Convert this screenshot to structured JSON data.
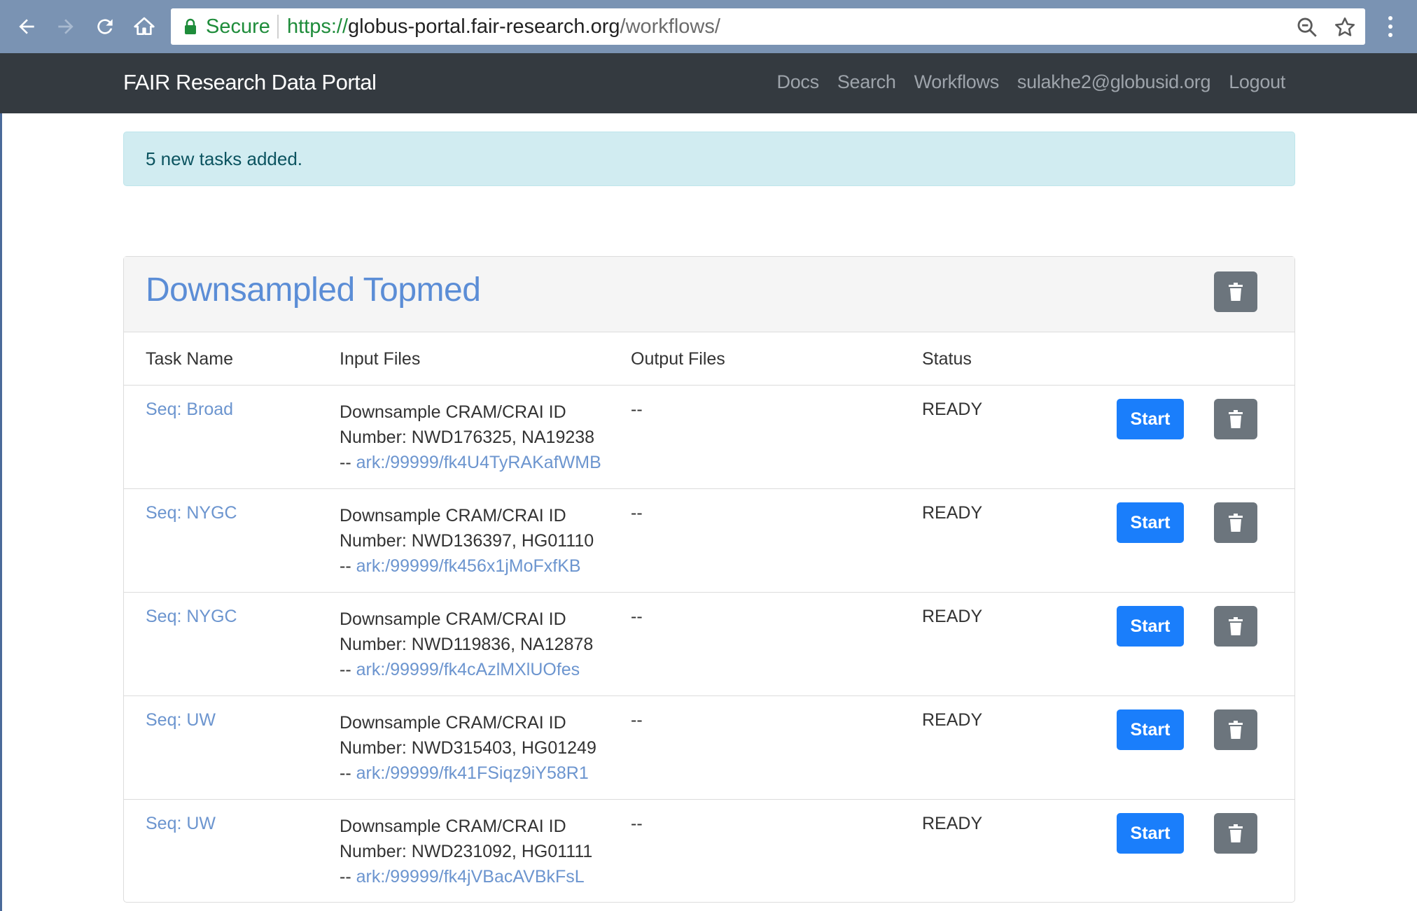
{
  "browser": {
    "secure_label": "Secure",
    "url_scheme": "https://",
    "url_host": "globus-portal.fair-research.org",
    "url_path": "/workflows/"
  },
  "navbar": {
    "brand": "FAIR Research Data Portal",
    "links": [
      "Docs",
      "Search",
      "Workflows",
      "sulakhe2@globusid.org",
      "Logout"
    ]
  },
  "alert": {
    "message": "5 new tasks added."
  },
  "workflow": {
    "title": "Downsampled Topmed",
    "columns": [
      "Task Name",
      "Input Files",
      "Output Files",
      "Status"
    ],
    "start_label": "Start",
    "tasks": [
      {
        "name": "Seq: Broad",
        "input_line1": "Downsample CRAM/CRAI ID",
        "input_line2": "Number: NWD176325, NA19238",
        "ark_prefix": "-- ",
        "ark": "ark:/99999/fk4U4TyRAKafWMB",
        "output": "--",
        "status": "READY"
      },
      {
        "name": "Seq: NYGC",
        "input_line1": "Downsample CRAM/CRAI ID",
        "input_line2": "Number: NWD136397, HG01110",
        "ark_prefix": "-- ",
        "ark": "ark:/99999/fk456x1jMoFxfKB",
        "output": "--",
        "status": "READY"
      },
      {
        "name": "Seq: NYGC",
        "input_line1": "Downsample CRAM/CRAI ID",
        "input_line2": "Number: NWD119836, NA12878",
        "ark_prefix": "-- ",
        "ark": "ark:/99999/fk4cAzlMXlUOfes",
        "output": "--",
        "status": "READY"
      },
      {
        "name": "Seq: UW",
        "input_line1": "Downsample CRAM/CRAI ID",
        "input_line2": "Number: NWD315403, HG01249",
        "ark_prefix": "-- ",
        "ark": "ark:/99999/fk41FSiqz9iY58R1",
        "output": "--",
        "status": "READY"
      },
      {
        "name": "Seq: UW",
        "input_line1": "Downsample CRAM/CRAI ID",
        "input_line2": "Number: NWD231092, HG01111",
        "ark_prefix": "-- ",
        "ark": "ark:/99999/fk4jVBacAVBkFsL",
        "output": "--",
        "status": "READY"
      }
    ]
  },
  "colors": {
    "browser_bar": "#7a93b3",
    "navbar": "#343a40",
    "primary": "#1a7efb",
    "secondary": "#6c757d",
    "link": "#6c95cf",
    "alert_bg": "#d1ecf1"
  },
  "icons": {
    "back": "arrow-left-icon",
    "forward": "arrow-right-icon",
    "reload": "reload-icon",
    "home": "home-icon",
    "lock": "lock-icon",
    "zoom": "zoom-icon",
    "bookmark": "star-icon",
    "menu": "kebab-menu-icon",
    "delete": "trash-icon"
  }
}
